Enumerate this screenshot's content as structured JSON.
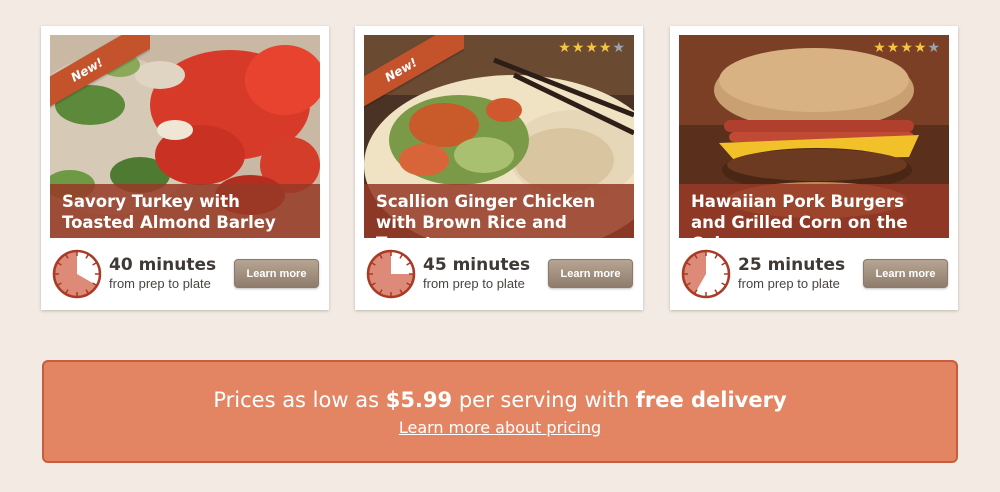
{
  "recipes": [
    {
      "title": "Savory Turkey with Toasted Almond Barley",
      "badge": "New!",
      "rating": null,
      "time_value": "40 minutes",
      "time_caption": "from prep to plate",
      "timer_fraction": 0.667,
      "button_label": "Learn more"
    },
    {
      "title": "Scallion Ginger Chicken with Brown Rice and Tomatoes",
      "badge": "New!",
      "rating": 4,
      "rating_max": 5,
      "time_value": "45 minutes",
      "time_caption": "from prep to plate",
      "timer_fraction": 0.75,
      "button_label": "Learn more"
    },
    {
      "title": "Hawaiian Pork Burgers and Grilled Corn on the Cob",
      "badge": null,
      "rating": 4,
      "rating_max": 5,
      "time_value": "25 minutes",
      "time_caption": "from prep to plate",
      "timer_fraction": 0.417,
      "button_label": "Learn more"
    }
  ],
  "banner": {
    "text_before": "Prices as low as",
    "price": "$5.99",
    "text_middle": "per serving with",
    "highlight": "free delivery",
    "link_text": "Learn more about pricing"
  },
  "colors": {
    "background": "#f3ebe3",
    "caption": "#963a26",
    "ribbon": "#c4532c",
    "timer_fill": "#dd8a78",
    "timer_ring": "#a83a26",
    "banner": "#e38563"
  }
}
